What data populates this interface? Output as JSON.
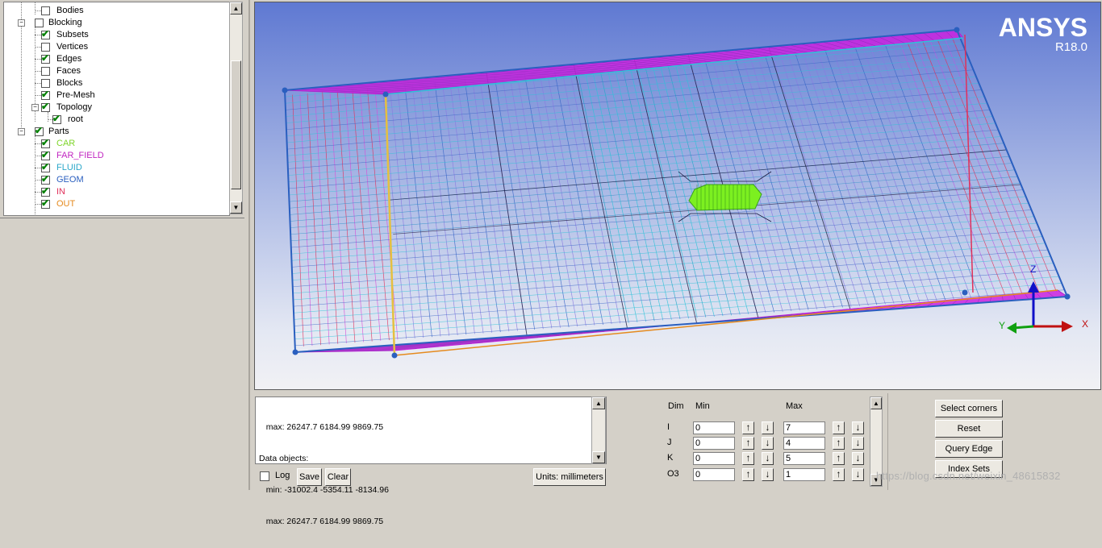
{
  "tree": {
    "items": [
      {
        "label": "Bodies",
        "checked": false,
        "color": "#000000"
      },
      {
        "label": "Blocking",
        "checked": false,
        "color": "#000000"
      },
      {
        "label": "Subsets",
        "checked": true,
        "color": "#000000"
      },
      {
        "label": "Vertices",
        "checked": false,
        "color": "#000000"
      },
      {
        "label": "Edges",
        "checked": true,
        "color": "#000000"
      },
      {
        "label": "Faces",
        "checked": false,
        "color": "#000000"
      },
      {
        "label": "Blocks",
        "checked": false,
        "color": "#000000"
      },
      {
        "label": "Pre-Mesh",
        "checked": true,
        "color": "#000000"
      },
      {
        "label": "Topology",
        "checked": true,
        "color": "#000000"
      },
      {
        "label": "root",
        "checked": true,
        "color": "#000000"
      },
      {
        "label": "Parts",
        "checked": true,
        "color": "#000000"
      },
      {
        "label": "CAR",
        "checked": true,
        "color": "#7fd52a"
      },
      {
        "label": "FAR_FIELD",
        "checked": true,
        "color": "#c024c0"
      },
      {
        "label": "FLUID",
        "checked": true,
        "color": "#2aa7c9"
      },
      {
        "label": "GEOM",
        "checked": true,
        "color": "#2a5fbf"
      },
      {
        "label": "IN",
        "checked": true,
        "color": "#e0305a"
      },
      {
        "label": "OUT",
        "checked": true,
        "color": "#e58a1e"
      }
    ]
  },
  "viewport": {
    "brand_name": "ANSYS",
    "brand_version": "R18.0",
    "axis_labels": {
      "z": "Z",
      "y": "Y",
      "x": "X"
    },
    "colors": {
      "farfield": "#cc22e0",
      "fluid": "#2ec2d8",
      "edge": "#2a5fbf",
      "inlet": "#e0305a",
      "outlet": "#e58a1e",
      "car": "#7cf020"
    }
  },
  "messages": {
    "lines": [
      "   max: 26247.7 6184.99 9869.75",
      "Data objects:",
      "   min: -31002.4 -5354.11 -8134.96",
      "   max: 26247.7 6184.99 9869.75"
    ],
    "log_label": "Log",
    "save_label": "Save",
    "clear_label": "Clear",
    "units_label": "Units: millimeters"
  },
  "index_control": {
    "headers": {
      "dim": "Dim",
      "min": "Min",
      "max": "Max"
    },
    "rows": [
      {
        "dim": "I",
        "min": "0",
        "max": "7"
      },
      {
        "dim": "J",
        "min": "0",
        "max": "4"
      },
      {
        "dim": "K",
        "min": "0",
        "max": "5"
      },
      {
        "dim": "O3",
        "min": "0",
        "max": "1"
      }
    ],
    "buttons": {
      "select_corners": "Select corners",
      "reset": "Reset",
      "query_edge": "Query Edge",
      "index_sets": "Index Sets"
    }
  },
  "watermark": "https://blog.csdn.net/weixin_48615832"
}
